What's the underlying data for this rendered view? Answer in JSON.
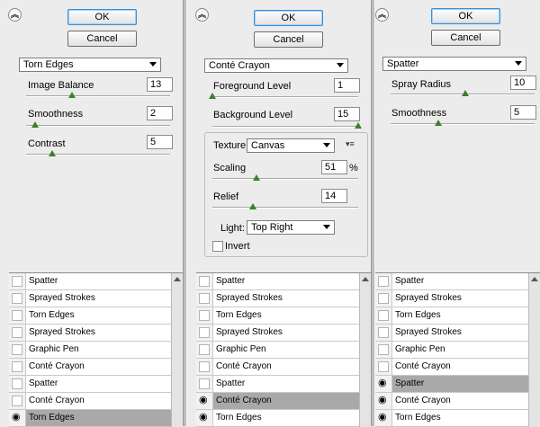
{
  "common": {
    "ok": "OK",
    "cancel": "Cancel",
    "collapse_icon": "double-chevron-up-icon"
  },
  "panel1": {
    "filter": "Torn Edges",
    "params": [
      {
        "label": "Image Balance",
        "value": "13"
      },
      {
        "label": "Smoothness",
        "value": "2"
      },
      {
        "label": "Contrast",
        "value": "5"
      }
    ],
    "layers": [
      {
        "name": "Spatter",
        "visible": false,
        "selected": false
      },
      {
        "name": "Sprayed Strokes",
        "visible": false,
        "selected": false
      },
      {
        "name": "Torn Edges",
        "visible": false,
        "selected": false
      },
      {
        "name": "Sprayed Strokes",
        "visible": false,
        "selected": false
      },
      {
        "name": "Graphic Pen",
        "visible": false,
        "selected": false
      },
      {
        "name": "Conté Crayon",
        "visible": false,
        "selected": false
      },
      {
        "name": "Spatter",
        "visible": false,
        "selected": false
      },
      {
        "name": "Conté Crayon",
        "visible": false,
        "selected": false
      },
      {
        "name": "Torn Edges",
        "visible": true,
        "selected": true
      }
    ]
  },
  "panel2": {
    "filter": "Conté Crayon",
    "params": [
      {
        "label": "Foreground Level",
        "value": "1"
      },
      {
        "label": "Background Level",
        "value": "15"
      }
    ],
    "texture_label": "Texture:",
    "texture_value": "Canvas",
    "scaling_label": "Scaling",
    "scaling_value": "51",
    "scaling_unit": "%",
    "relief_label": "Relief",
    "relief_value": "14",
    "light_label": "Light:",
    "light_value": "Top Right",
    "invert_label": "Invert",
    "layers": [
      {
        "name": "Spatter",
        "visible": false,
        "selected": false
      },
      {
        "name": "Sprayed Strokes",
        "visible": false,
        "selected": false
      },
      {
        "name": "Torn Edges",
        "visible": false,
        "selected": false
      },
      {
        "name": "Sprayed Strokes",
        "visible": false,
        "selected": false
      },
      {
        "name": "Graphic Pen",
        "visible": false,
        "selected": false
      },
      {
        "name": "Conté Crayon",
        "visible": false,
        "selected": false
      },
      {
        "name": "Spatter",
        "visible": false,
        "selected": false
      },
      {
        "name": "Conté Crayon",
        "visible": true,
        "selected": true
      },
      {
        "name": "Torn Edges",
        "visible": true,
        "selected": false
      }
    ]
  },
  "panel3": {
    "filter": "Spatter",
    "params": [
      {
        "label": "Spray Radius",
        "value": "10"
      },
      {
        "label": "Smoothness",
        "value": "5"
      }
    ],
    "layers": [
      {
        "name": "Spatter",
        "visible": false,
        "selected": false
      },
      {
        "name": "Sprayed Strokes",
        "visible": false,
        "selected": false
      },
      {
        "name": "Torn Edges",
        "visible": false,
        "selected": false
      },
      {
        "name": "Sprayed Strokes",
        "visible": false,
        "selected": false
      },
      {
        "name": "Graphic Pen",
        "visible": false,
        "selected": false
      },
      {
        "name": "Conté Crayon",
        "visible": false,
        "selected": false
      },
      {
        "name": "Spatter",
        "visible": true,
        "selected": true
      },
      {
        "name": "Conté Crayon",
        "visible": true,
        "selected": false
      },
      {
        "name": "Torn Edges",
        "visible": true,
        "selected": false
      }
    ]
  },
  "slider_levels": {
    "p1": [
      0.32,
      0.06,
      0.18
    ],
    "p2": [
      0.0,
      1.0,
      0.3,
      0.28
    ],
    "p3": [
      0.52,
      0.33
    ]
  }
}
